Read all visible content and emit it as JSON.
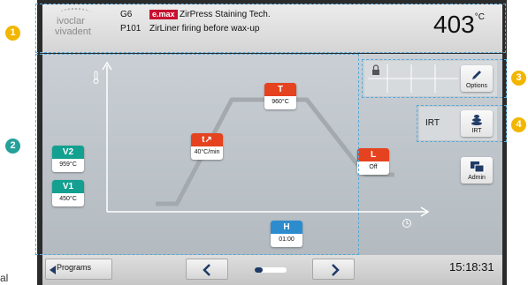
{
  "header": {
    "brand_line1": "ivoclar",
    "brand_line2": "vivadent",
    "code_g": "G6",
    "badge": "e.max",
    "material": "ZirPress Staining Tech.",
    "code_p": "P101",
    "program_name": "ZirLiner firing before wax-up",
    "temperature": "403",
    "temperature_unit": "°C"
  },
  "callouts": [
    "1",
    "2",
    "3",
    "4"
  ],
  "params": {
    "v2": {
      "label": "V2",
      "value": "959°C"
    },
    "v1": {
      "label": "V1",
      "value": "450°C"
    },
    "t_rate": {
      "label": "t↗",
      "value": "40°C/min"
    },
    "t_hold": {
      "label": "T",
      "value": "960°C"
    },
    "l": {
      "label": "L",
      "value": "Off"
    },
    "h": {
      "label": "H",
      "value": "01:00"
    }
  },
  "side": {
    "options_label": "Options",
    "irt_text": "IRT",
    "irt_label": "IRT",
    "admin_label": "Admin"
  },
  "footer": {
    "programs_label": "Programs",
    "time": "15:18:31"
  },
  "stray_text": "al",
  "icons": [
    "lock-icon",
    "pencil-icon",
    "irt-icon",
    "admin-icon",
    "thermometer-icon",
    "clock-icon",
    "chevron-left-icon",
    "chevron-right-icon"
  ],
  "colors": {
    "teal": "#13a090",
    "red": "#e5421f",
    "blue": "#2d8ccd",
    "callout_yellow": "#f2b600",
    "callout_green": "#25a09a",
    "badge_red": "#c8102e"
  }
}
